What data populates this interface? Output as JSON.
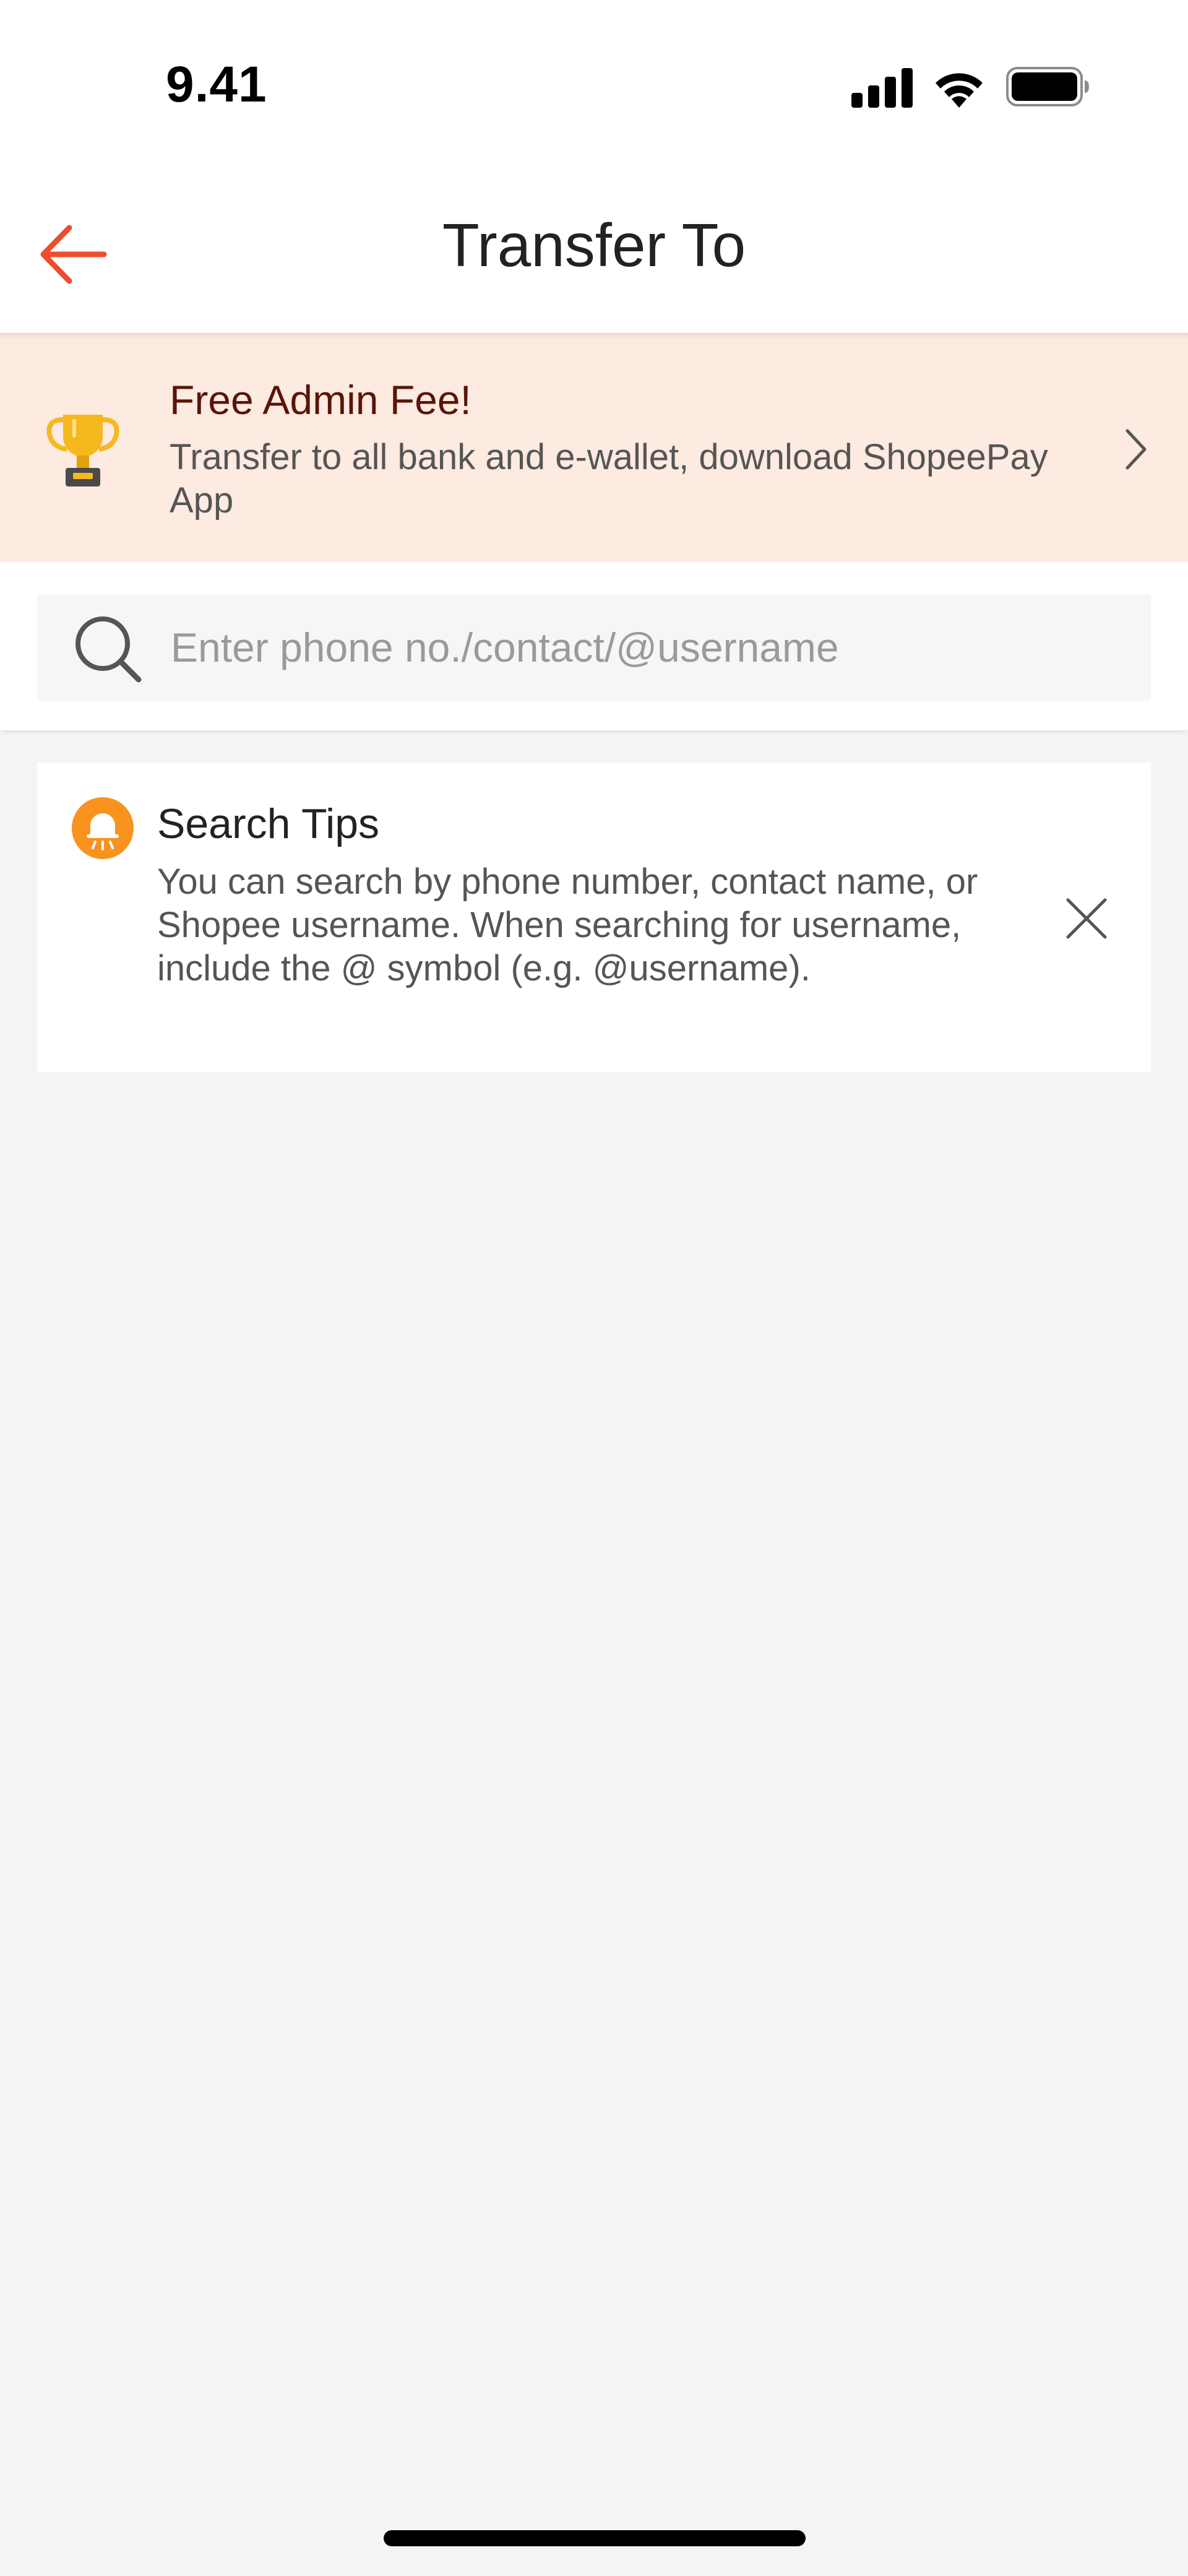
{
  "status_bar": {
    "time": "9.41",
    "icons": [
      "signal-icon",
      "wifi-icon",
      "battery-icon"
    ]
  },
  "nav": {
    "back_icon": "arrow-left-icon",
    "title": "Transfer To"
  },
  "promo": {
    "icon": "trophy-icon",
    "title": "Free Admin Fee!",
    "description": "Transfer to all bank and e-wallet, download ShopeePay App",
    "chevron_icon": "chevron-right-icon"
  },
  "search": {
    "icon": "search-icon",
    "value": "",
    "placeholder": "Enter phone no./contact/@username"
  },
  "tips": {
    "icon": "bell-icon",
    "title": "Search Tips",
    "body": "You can search by phone number, contact name, or Shopee username. When searching for username, include the @ symbol (e.g. @username).",
    "close_icon": "close-icon"
  },
  "colors": {
    "accent": "#ee4d2d",
    "promo_background": "#fdeae1",
    "promo_title": "#5a1508",
    "tips_icon": "#f7931e",
    "page_background": "#f4f4f4"
  }
}
